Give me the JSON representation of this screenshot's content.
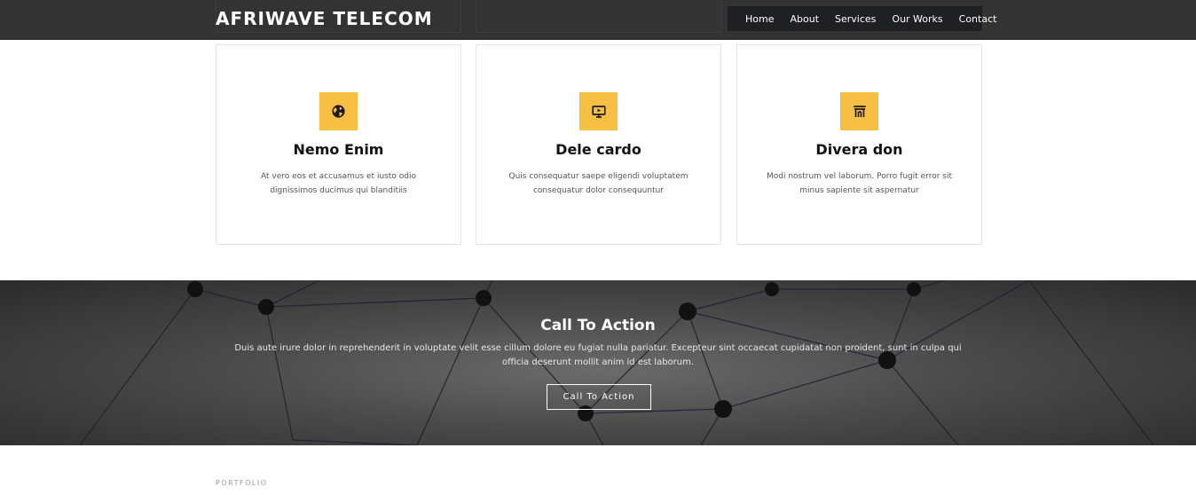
{
  "header": {
    "brand": "AFRIWAVE TELECOM",
    "nav": [
      "Home",
      "About",
      "Services",
      "Our Works",
      "Contact"
    ]
  },
  "features": [
    {
      "icon": "globe-icon",
      "title": "Nemo Enim",
      "text": "At vero eos et accusamus et iusto odio dignissimos ducimus qui blanditiis"
    },
    {
      "icon": "presentation-screen-icon",
      "title": "Dele cardo",
      "text": "Quis consequatur saepe eligendi voluptatem consequatur dolor consequuntur"
    },
    {
      "icon": "archway-icon",
      "title": "Divera don",
      "text": "Modi nostrum vel laborum. Porro fugit error sit minus sapiente sit aspernatur"
    }
  ],
  "cta": {
    "title": "Call To Action",
    "text": "Duis aute irure dolor in reprehenderit in voluptate velit esse cillum dolore eu fugiat nulla pariatur. Excepteur sint occaecat cupidatat non proident, sunt in culpa qui officia deserunt mollit anim id est laborum.",
    "button": "Call To Action"
  },
  "portfolio": {
    "label": "PORTFOLIO"
  },
  "colors": {
    "header_bg": "#333333",
    "nav_bg": "#1f2024",
    "accent": "#f8bf45"
  }
}
